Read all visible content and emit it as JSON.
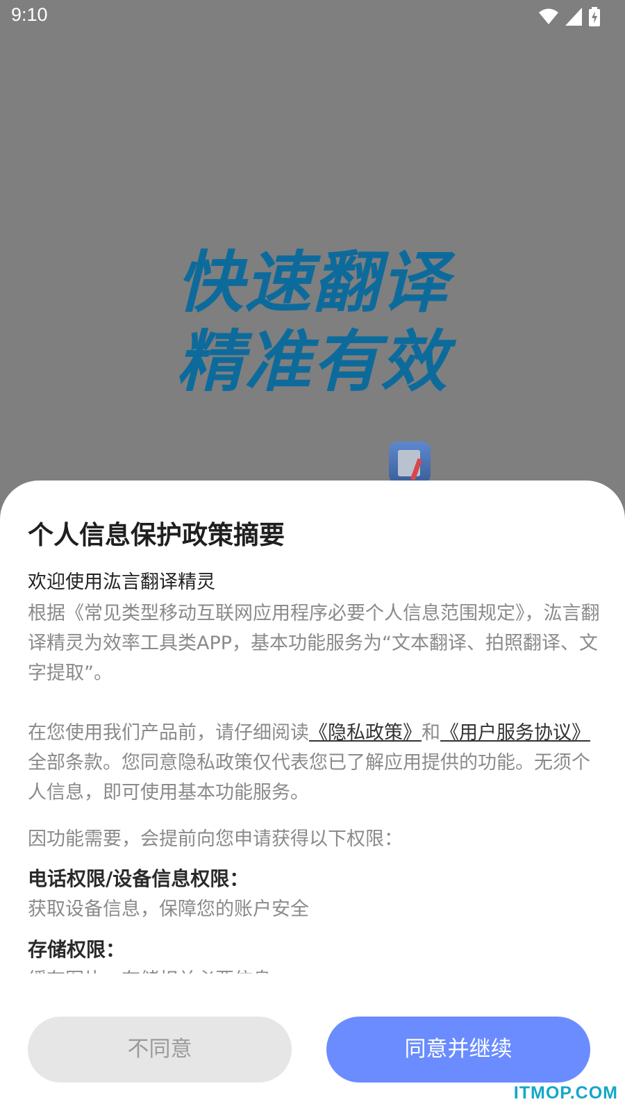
{
  "status_bar": {
    "time": "9:10",
    "icons": [
      "wifi-icon",
      "signal-icon",
      "battery-charging-icon"
    ]
  },
  "splash": {
    "slogan_line1": "快速翻译",
    "slogan_line2": "精准有效",
    "logo_icon": "translator-app-logo"
  },
  "dialog": {
    "title": "个人信息保护政策摘要",
    "welcome": "欢迎使用汯言翻译精灵",
    "para1": "根据《常见类型移动互联网应用程序必要个人信息范围规定》，汯言翻译精灵为效率工具类APP，基本功能服务为“文本翻译、拍照翻译、文字提取”。",
    "para2_prefix": "在您使用我们产品前，请仔细阅读",
    "privacy_link": "《隐私政策》",
    "para2_and": "和",
    "service_link": "《用户服务协议》",
    "para2_suffix": "全部条款。您同意隐私政策仅代表您已了解应用提供的功能。无须个人信息，即可使用基本功能服务。",
    "para3": "因功能需要，会提前向您申请获得以下权限：",
    "permissions": [
      {
        "title": "电话权限/设备信息权限：",
        "desc": "获取设备信息，保障您的账户安全"
      },
      {
        "title": "存储权限：",
        "desc": "缓存图片，存储相关必要信息"
      }
    ],
    "decline_label": "不同意",
    "accept_label": "同意并继续"
  },
  "watermark": "ITMOP.COM",
  "colors": {
    "accent": "#6a8cff",
    "slogan": "#0d6b9c",
    "overlay": "#7f7f7f",
    "watermark": "#13a7c8"
  }
}
